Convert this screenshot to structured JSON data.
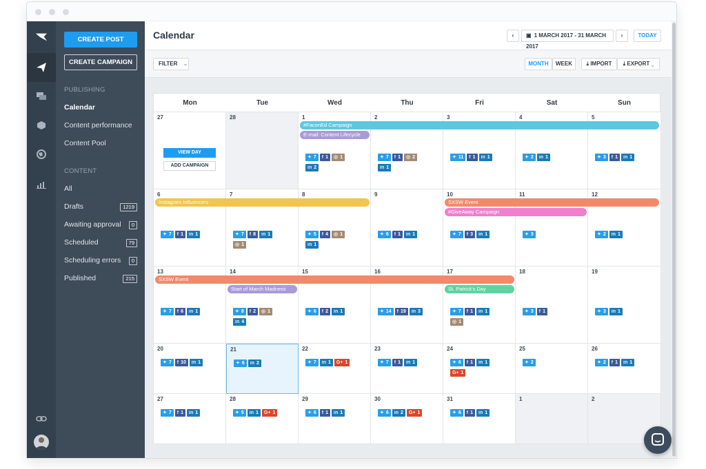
{
  "header": {
    "title": "Calendar",
    "date_range": "1 MARCH 2017 - 31 MARCH 2017",
    "today_label": "TODAY"
  },
  "toolbar": {
    "filter_label": "FILTER",
    "month_label": "MONTH",
    "week_label": "WEEK",
    "import_label": "IMPORT",
    "export_label": "EXPORT"
  },
  "sidebar": {
    "create_post": "CREATE POST",
    "create_campaign": "CREATE CAMPAIGN",
    "publishing_heading": "PUBLISHING",
    "publishing_items": [
      {
        "label": "Calendar"
      },
      {
        "label": "Content performance"
      },
      {
        "label": "Content Pool"
      }
    ],
    "content_heading": "CONTENT",
    "content_items": [
      {
        "label": "All",
        "count": ""
      },
      {
        "label": "Drafts",
        "count": "1219"
      },
      {
        "label": "Awaiting approval",
        "count": "0"
      },
      {
        "label": "Scheduled",
        "count": "79"
      },
      {
        "label": "Scheduling errors",
        "count": "0"
      },
      {
        "label": "Published",
        "count": "215"
      }
    ]
  },
  "calendar": {
    "days": [
      "Mon",
      "Tue",
      "Wed",
      "Thu",
      "Fri",
      "Sat",
      "Sun"
    ],
    "view_day_label": "VIEW DAY",
    "add_campaign_label": "ADD CAMPAIGN",
    "weeks": [
      {
        "dates": [
          "27",
          "28",
          "1",
          "2",
          "3",
          "4",
          "5"
        ]
      },
      {
        "dates": [
          "6",
          "7",
          "8",
          "9",
          "10",
          "11",
          "12"
        ]
      },
      {
        "dates": [
          "13",
          "14",
          "15",
          "16",
          "17",
          "18",
          "19"
        ]
      },
      {
        "dates": [
          "20",
          "21",
          "22",
          "23",
          "24",
          "25",
          "26"
        ]
      },
      {
        "dates": [
          "27",
          "28",
          "29",
          "30",
          "31",
          "1",
          "2"
        ]
      }
    ],
    "events": [
      {
        "label": "#FaconEd Campaign",
        "color": "#5bc8de"
      },
      {
        "label": "E-mail: Content Lifecycle",
        "color": "#a99ad8"
      },
      {
        "label": "Instagram Influencers",
        "color": "#f2c450"
      },
      {
        "label": "SXSW Event",
        "color": "#f2896a"
      },
      {
        "label": "#GiveAway Campaign",
        "color": "#ee80cf"
      },
      {
        "label": "SXSW Event",
        "color": "#f2896a"
      },
      {
        "label": "Start of March Madness",
        "color": "#a99ad8"
      },
      {
        "label": "St. Patrick's Day",
        "color": "#5fd3a0"
      }
    ],
    "posts": {
      "w0": [
        [],
        [],
        [
          [
            "tw",
            "7"
          ],
          [
            "fb",
            "1"
          ],
          [
            "ig",
            "1"
          ],
          [
            "li",
            "2"
          ]
        ],
        [
          [
            "tw",
            "7"
          ],
          [
            "fb",
            "1"
          ],
          [
            "ig",
            "2"
          ],
          [
            "li",
            "1"
          ]
        ],
        [
          [
            "tw",
            "11"
          ],
          [
            "fb",
            "1"
          ],
          [
            "li",
            "1"
          ]
        ],
        [
          [
            "tw",
            "2"
          ],
          [
            "li",
            "1"
          ]
        ],
        [
          [
            "tw",
            "3"
          ],
          [
            "fb",
            "1"
          ],
          [
            "li",
            "1"
          ]
        ]
      ],
      "w1": [
        [
          [
            "tw",
            "7"
          ],
          [
            "fb",
            "1"
          ],
          [
            "li",
            "1"
          ]
        ],
        [
          [
            "tw",
            "7"
          ],
          [
            "fb",
            "8"
          ],
          [
            "li",
            "1"
          ],
          [
            "ig",
            "1"
          ]
        ],
        [
          [
            "tw",
            "5"
          ],
          [
            "fb",
            "4"
          ],
          [
            "ig",
            "1"
          ],
          [
            "li",
            "1"
          ]
        ],
        [
          [
            "tw",
            "6"
          ],
          [
            "fb",
            "1"
          ],
          [
            "li",
            "1"
          ]
        ],
        [
          [
            "tw",
            "7"
          ],
          [
            "fb",
            "3"
          ],
          [
            "li",
            "1"
          ]
        ],
        [
          [
            "tw",
            "3"
          ]
        ],
        [
          [
            "tw",
            "2"
          ],
          [
            "li",
            "1"
          ]
        ]
      ],
      "w2": [
        [
          [
            "tw",
            "7"
          ],
          [
            "fb",
            "6"
          ],
          [
            "li",
            "1"
          ]
        ],
        [
          [
            "tw",
            "8"
          ],
          [
            "fb",
            "2"
          ],
          [
            "ig",
            "1"
          ],
          [
            "li",
            "4"
          ]
        ],
        [
          [
            "tw",
            "6"
          ],
          [
            "fb",
            "2"
          ],
          [
            "li",
            "1"
          ]
        ],
        [
          [
            "tw",
            "14"
          ],
          [
            "fb",
            "19"
          ],
          [
            "li",
            "3"
          ]
        ],
        [
          [
            "tw",
            "7"
          ],
          [
            "fb",
            "1"
          ],
          [
            "li",
            "1"
          ],
          [
            "ig",
            "1"
          ]
        ],
        [
          [
            "tw",
            "3"
          ],
          [
            "fb",
            "1"
          ]
        ],
        [
          [
            "tw",
            "3"
          ],
          [
            "li",
            "1"
          ]
        ]
      ],
      "w3": [
        [
          [
            "tw",
            "7"
          ],
          [
            "fb",
            "10"
          ],
          [
            "li",
            "1"
          ]
        ],
        [
          [
            "tw",
            "6"
          ],
          [
            "li",
            "2"
          ]
        ],
        [
          [
            "tw",
            "7"
          ],
          [
            "li",
            "1"
          ],
          [
            "gp",
            "1"
          ]
        ],
        [
          [
            "tw",
            "7"
          ],
          [
            "fb",
            "1"
          ],
          [
            "li",
            "1"
          ]
        ],
        [
          [
            "tw",
            "6"
          ],
          [
            "fb",
            "1"
          ],
          [
            "li",
            "1"
          ],
          [
            "gp",
            "1"
          ]
        ],
        [
          [
            "tw",
            "2"
          ]
        ],
        [
          [
            "tw",
            "2"
          ],
          [
            "fb",
            "1"
          ],
          [
            "li",
            "1"
          ]
        ]
      ],
      "w4": [
        [
          [
            "tw",
            "7"
          ],
          [
            "fb",
            "1"
          ],
          [
            "li",
            "1"
          ]
        ],
        [
          [
            "tw",
            "5"
          ],
          [
            "li",
            "1"
          ],
          [
            "gp",
            "1"
          ]
        ],
        [
          [
            "tw",
            "6"
          ],
          [
            "fb",
            "1"
          ],
          [
            "li",
            "1"
          ]
        ],
        [
          [
            "tw",
            "6"
          ],
          [
            "li",
            "2"
          ],
          [
            "gp",
            "1"
          ]
        ],
        [
          [
            "tw",
            "6"
          ],
          [
            "fb",
            "1"
          ],
          [
            "li",
            "1"
          ]
        ],
        [],
        []
      ]
    }
  },
  "icons": {
    "tw": "twitter-icon",
    "fb": "facebook-icon",
    "li": "linkedin-icon",
    "ig": "instagram-icon",
    "gp": "google-plus-icon"
  }
}
